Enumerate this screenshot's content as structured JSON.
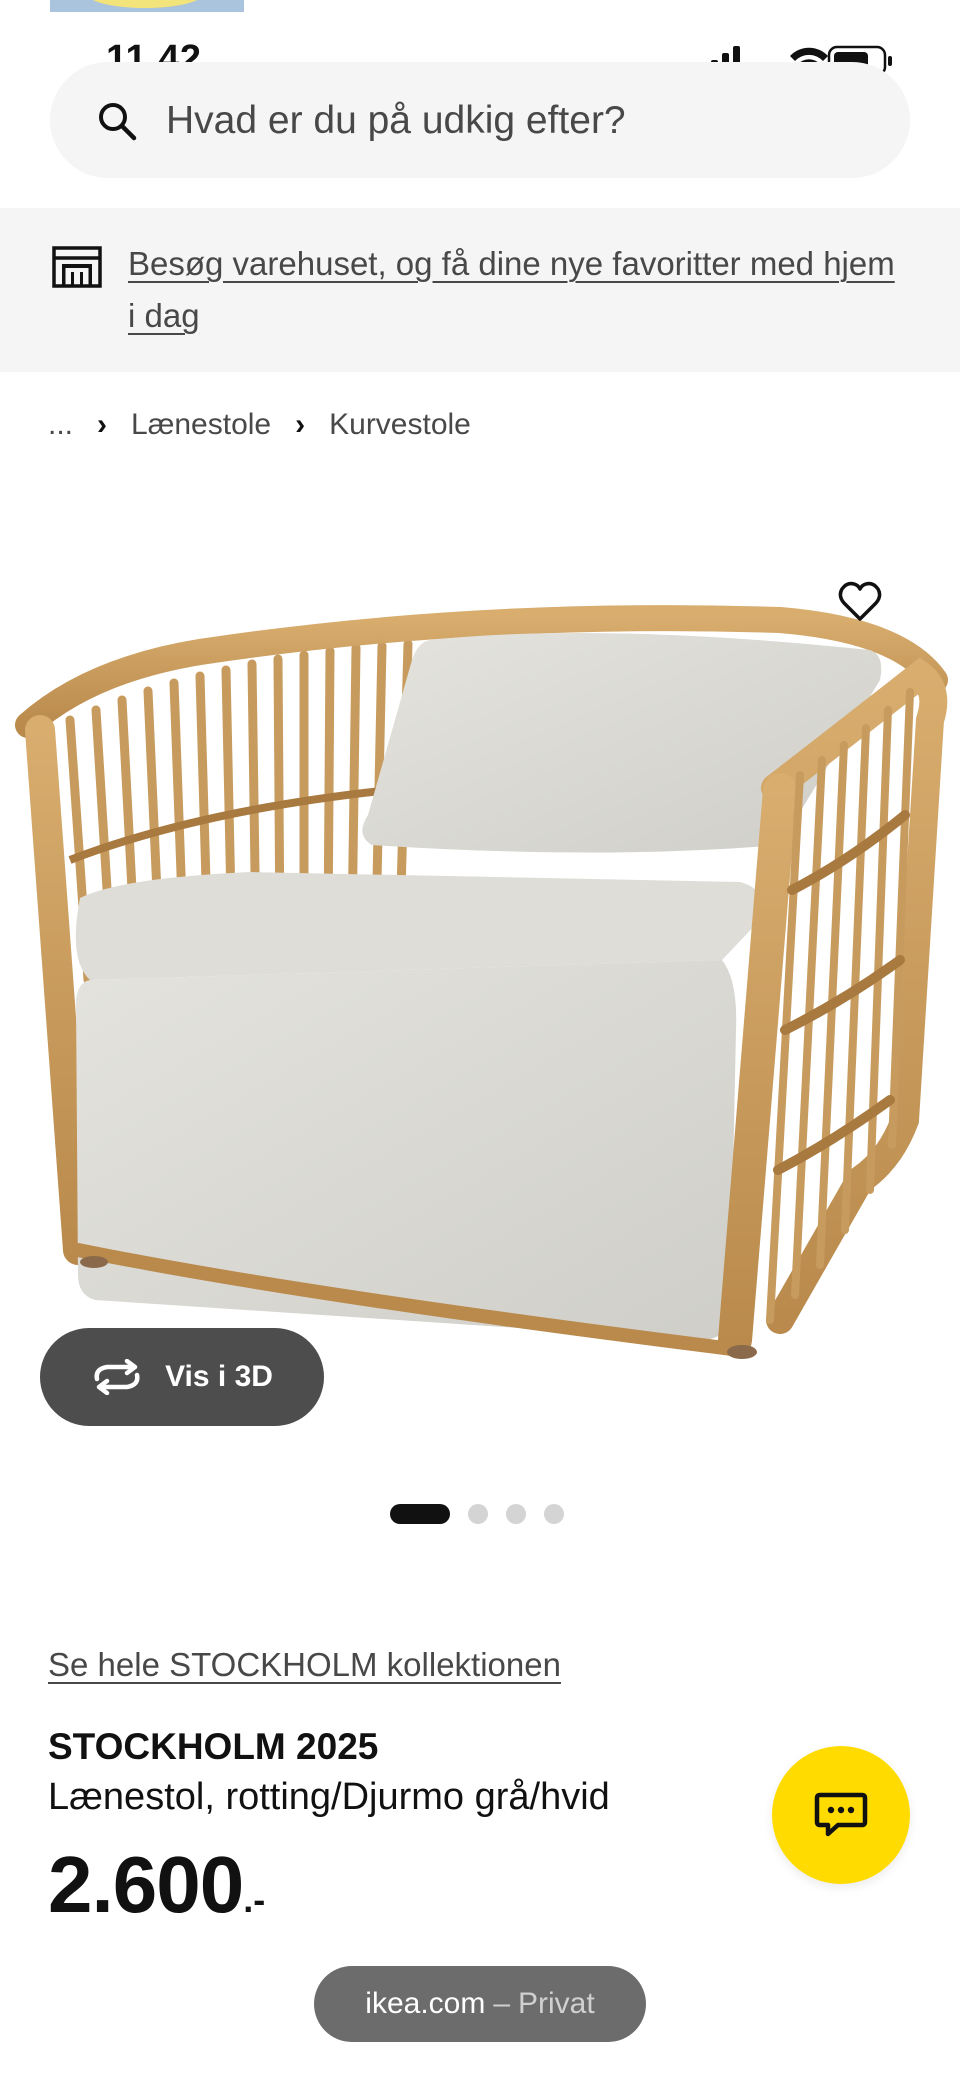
{
  "status_bar": {
    "time": "11.42"
  },
  "search": {
    "placeholder": "Hvad er du på udkig efter?"
  },
  "banner": {
    "link_text": "Besøg varehuset, og få dine nye favoritter med hjem i dag"
  },
  "breadcrumb": {
    "items": [
      "...",
      "Lænestole",
      "Kurvestole"
    ]
  },
  "gallery": {
    "view_3d_label": "Vis i 3D",
    "page_count": 4,
    "active_index": 0
  },
  "product": {
    "collection_link": "Se hele STOCKHOLM kollektionen",
    "name": "STOCKHOLM 2025",
    "description": "Lænestol, rotting/Djurmo grå/hvid",
    "price_integer": "2.600",
    "price_suffix": ".-"
  },
  "browser": {
    "domain": "ikea.com",
    "separator": "–",
    "mode": "Privat"
  },
  "colors": {
    "accent_yellow": "#ffdb00",
    "banner_bg": "#f5f5f5",
    "button_dark": "#4d4d4d"
  }
}
